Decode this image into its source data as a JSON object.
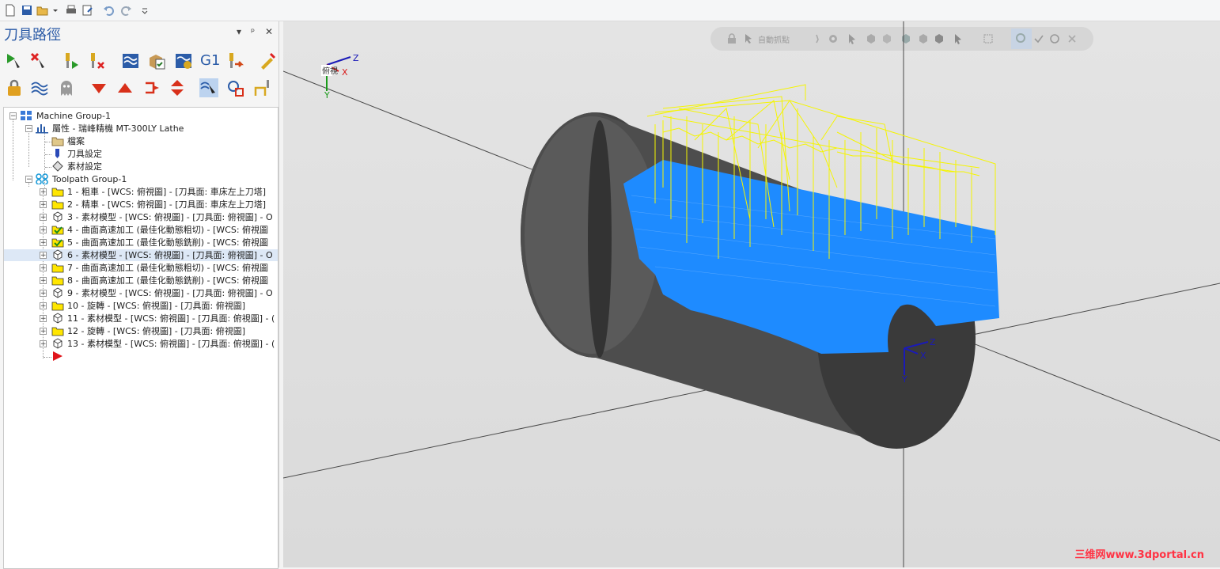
{
  "panel": {
    "title": "刀具路徑",
    "controls": [
      "▾",
      "ᵖ",
      "✕"
    ]
  },
  "viewport_toolbar": {
    "label": "自動抓點"
  },
  "tree": {
    "root": "Machine Group-1",
    "properties": "屬性 - 瑞峰精機 MT-300LY Lathe",
    "prop_children": [
      "檔案",
      "刀具設定",
      "素材設定"
    ],
    "group": "Toolpath Group-1",
    "operations": [
      "1 - 粗車 - [WCS: 俯視圖] - [刀具面: 車床左上刀塔]",
      "2 - 精車 - [WCS: 俯視圖] - [刀具面: 車床左上刀塔]",
      "3 - 素材模型 - [WCS: 俯視圖] - [刀具面: 俯視圖] - O",
      "4 - 曲面高速加工 (最佳化動態粗切) - [WCS: 俯視圖",
      "5 - 曲面高速加工 (最佳化動態銑削) - [WCS: 俯視圖",
      "6 - 素材模型 - [WCS: 俯視圖] - [刀具面: 俯視圖] - O",
      "7 - 曲面高速加工 (最佳化動態粗切) - [WCS: 俯視圖",
      "8 - 曲面高速加工 (最佳化動態銑削) - [WCS: 俯視圖",
      "9 - 素材模型 - [WCS: 俯視圖] - [刀具面: 俯視圖] - O",
      "10 - 旋轉 - [WCS: 俯視圖] - [刀具面: 俯視圖]",
      "11 - 素材模型 - [WCS: 俯視圖] - [刀具面: 俯視圖] - (",
      "12 - 旋轉 - [WCS: 俯視圖] - [刀具面: 俯視圖]",
      "13 - 素材模型 - [WCS: 俯視圖] - [刀具面: 俯視圖] - ("
    ],
    "op_icons": [
      "folder",
      "folder",
      "stock",
      "folder-check",
      "folder-check",
      "stock",
      "folder",
      "folder",
      "stock",
      "folder",
      "stock",
      "folder",
      "stock"
    ],
    "selected_index": 5
  },
  "axes": {
    "x": "X",
    "y": "Y",
    "z": "Z",
    "view_label": "俯視"
  },
  "watermark": "三维网www.3dportal.cn",
  "colors": {
    "title_blue": "#2a5aa6",
    "toolpath_blue": "#1e8bff",
    "toolpath_yellow": "#f5f500",
    "part_gray": "#4a4a4a",
    "folder_yellow": "#ffe600"
  }
}
